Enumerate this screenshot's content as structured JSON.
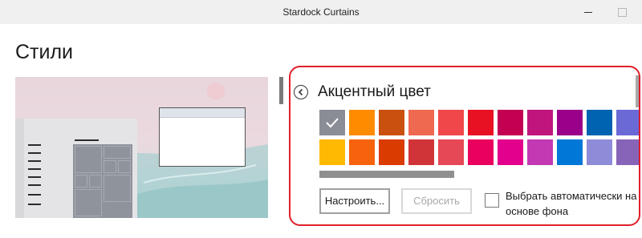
{
  "window": {
    "title": "Stardock Curtains"
  },
  "page": {
    "title": "Стили"
  },
  "accent": {
    "title": "Акцентный цвет",
    "selected": "#8b8d96",
    "colors_row1": [
      "#8b8d96",
      "#ff8c00",
      "#ca5010",
      "#ef6950",
      "#f0484a",
      "#e81123",
      "#c30052",
      "#c0157c",
      "#9a0089",
      "#0063b1",
      "#6b69d6"
    ],
    "colors_row2": [
      "#ffb900",
      "#f7630c",
      "#da3b01",
      "#d13438",
      "#e74856",
      "#ea005e",
      "#e3008c",
      "#c239b3",
      "#0078d7",
      "#8e8cd8",
      "#8764b8"
    ],
    "customize_label": "Настроить...",
    "reset_label": "Сбросить",
    "auto_label": "Выбрать автоматически на основе фона",
    "auto_checked": false
  },
  "icons": {
    "back": "back-arrow-icon",
    "check": "check-icon",
    "minimize": "minimize-icon",
    "maximize": "maximize-icon"
  }
}
